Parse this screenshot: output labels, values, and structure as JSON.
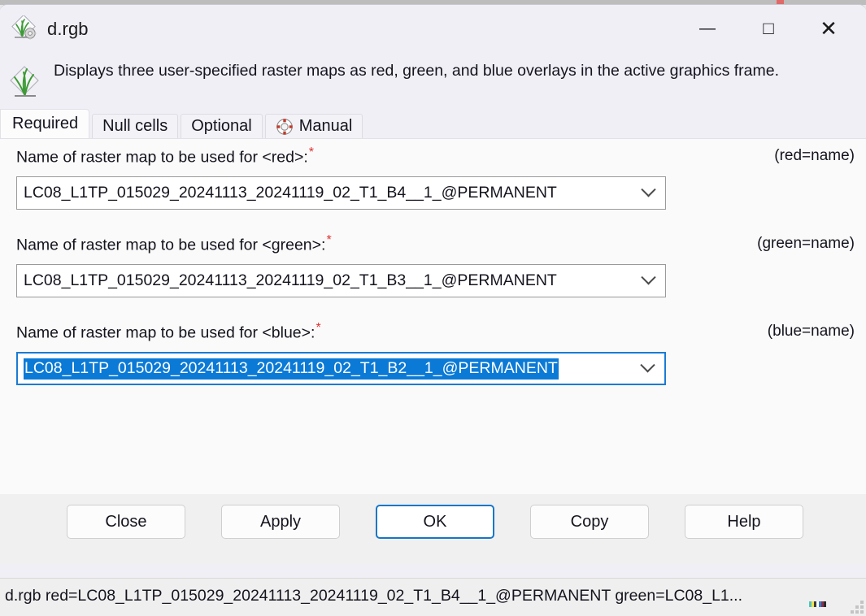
{
  "window": {
    "title": "d.rgb",
    "app_icon": "grass-gis-icon",
    "controls": {
      "minimize": "—",
      "maximize": "□",
      "close": "✕"
    }
  },
  "description": {
    "icon": "grass-gis-logo-icon",
    "text": "Displays three user-specified raster maps as red, green, and blue overlays in the active graphics frame."
  },
  "tabs": [
    {
      "label": "Required",
      "active": true,
      "icon": null
    },
    {
      "label": "Null cells",
      "active": false,
      "icon": null
    },
    {
      "label": "Optional",
      "active": false,
      "icon": null
    },
    {
      "label": "Manual",
      "active": false,
      "icon": "lifebuoy-icon"
    }
  ],
  "fields": [
    {
      "label": "Name of raster map to be used for <red>:",
      "required": true,
      "hint": "(red=name)",
      "value": "LC08_L1TP_015029_20241113_20241119_02_T1_B4__1_@PERMANENT",
      "focused": false
    },
    {
      "label": "Name of raster map to be used for <green>:",
      "required": true,
      "hint": "(green=name)",
      "value": "LC08_L1TP_015029_20241113_20241119_02_T1_B3__1_@PERMANENT",
      "focused": false
    },
    {
      "label": "Name of raster map to be used for <blue>:",
      "required": true,
      "hint": "(blue=name)",
      "value": "LC08_L1TP_015029_20241113_20241119_02_T1_B2__1_@PERMANENT",
      "focused": true
    }
  ],
  "buttons": {
    "close": "Close",
    "apply": "Apply",
    "ok": "OK",
    "copy": "Copy",
    "help": "Help",
    "default": "OK"
  },
  "status": {
    "command": "d.rgb red=LC08_L1TP_015029_20241113_20241119_02_T1_B4__1_@PERMANENT green=LC08_L1..."
  },
  "colors": {
    "accent": "#1576c8",
    "selection": "#0b7ad6",
    "required_star": "#e03030",
    "window_bg": "#f1eff6",
    "panel_bg": "#fafafa",
    "strip_bg": "#f0f0f0",
    "status_bg": "#efefef"
  }
}
